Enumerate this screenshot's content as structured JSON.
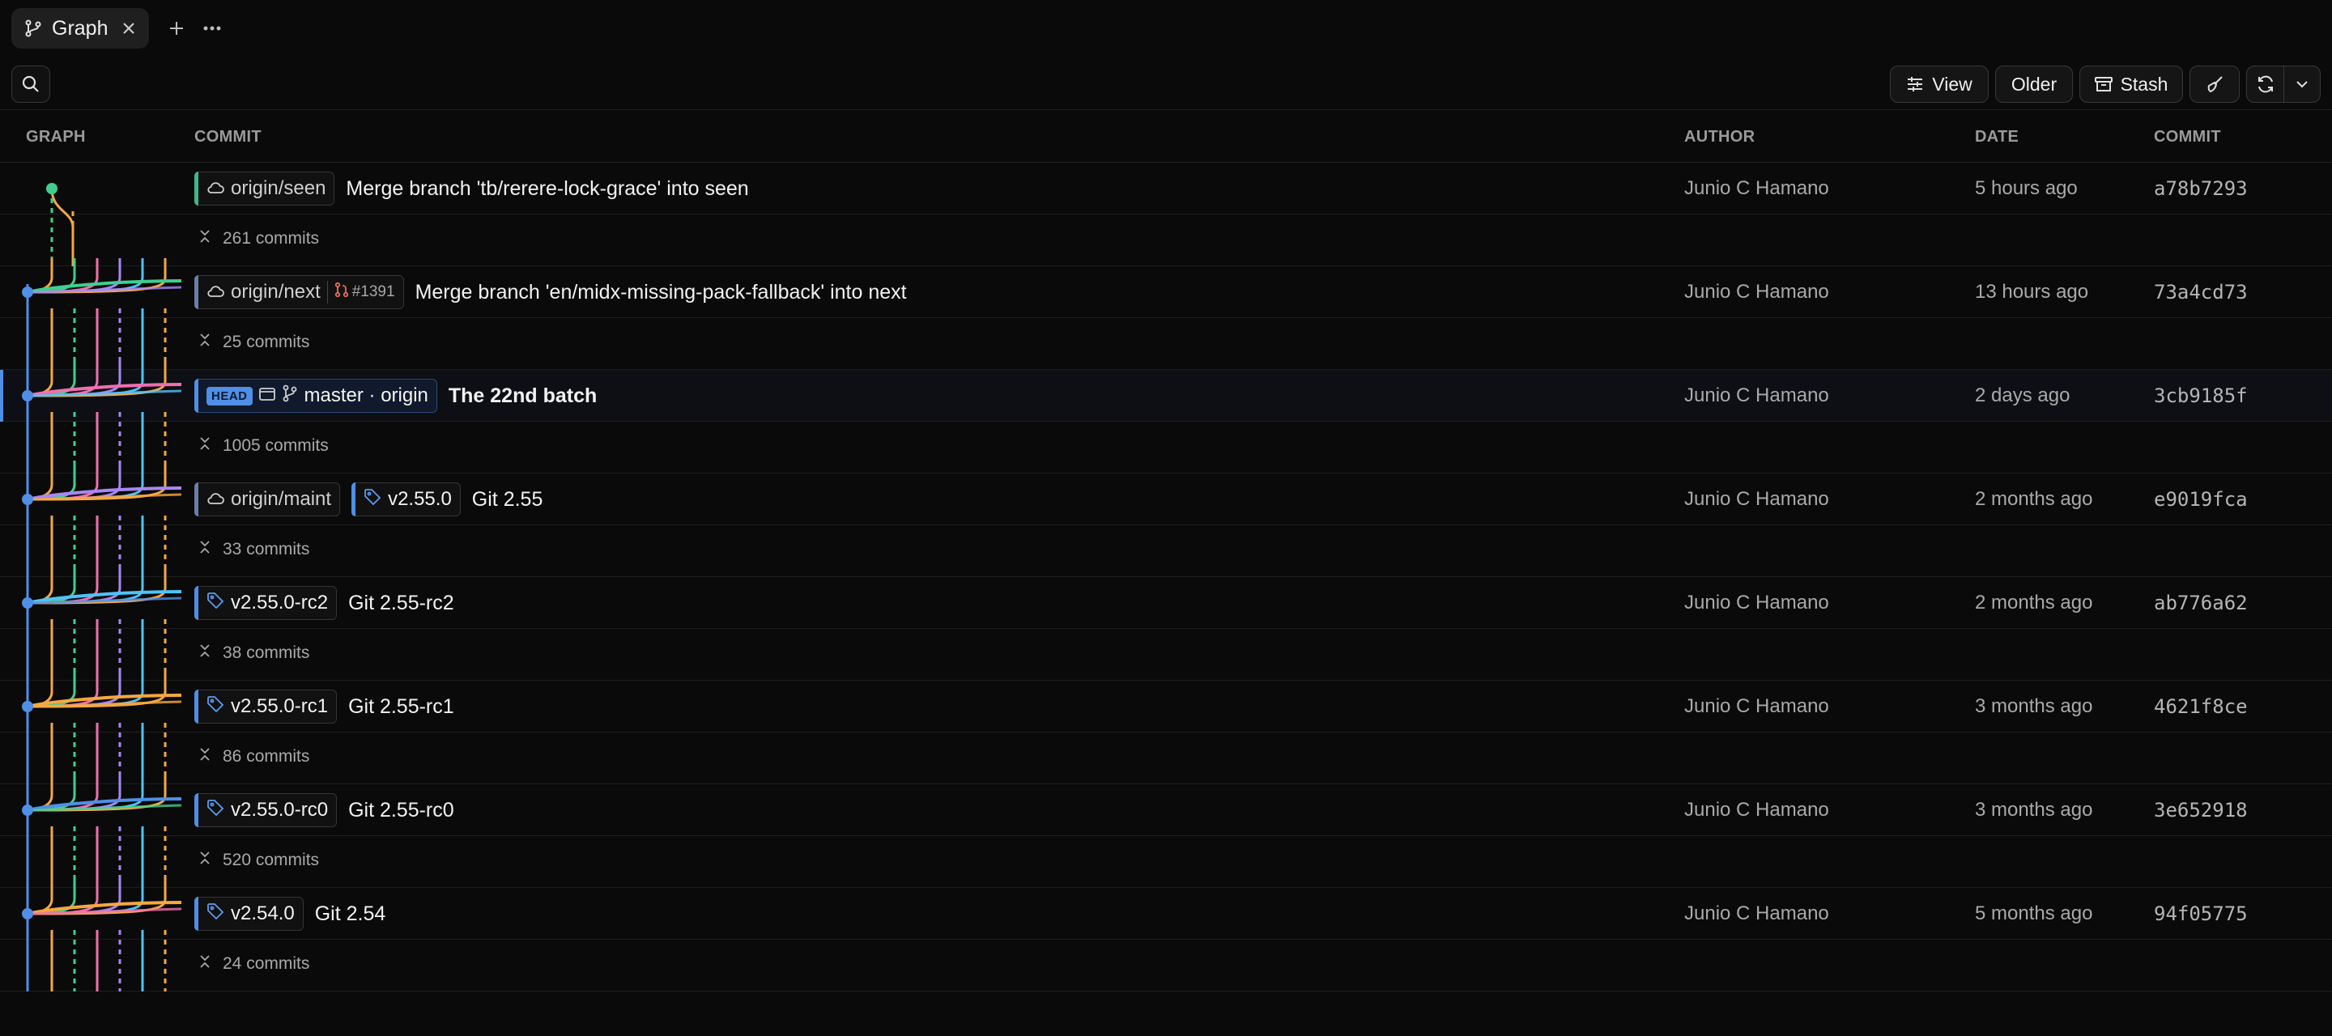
{
  "tab": {
    "label": "Graph",
    "icon": "git-graph-icon"
  },
  "toolbar": {
    "view_label": "View",
    "older_label": "Older",
    "stash_label": "Stash"
  },
  "columns": {
    "graph": "GRAPH",
    "commit": "COMMIT",
    "author": "AUTHOR",
    "date": "DATE",
    "sha": "COMMIT"
  },
  "rows": [
    {
      "refs": [
        {
          "type": "remote",
          "label": "origin/seen",
          "color": "#3fb58f"
        }
      ],
      "message": "Merge branch 'tb/rerere-lock-grace' into seen",
      "author": "Junio C Hamano",
      "date": "5 hours ago",
      "sha": "a78b7293",
      "collapsed": "261 commits"
    },
    {
      "refs": [
        {
          "type": "remote",
          "label": "origin/next",
          "pr": "#1391",
          "color": "#6a7fa8"
        }
      ],
      "message": "Merge branch 'en/midx-missing-pack-fallback' into next",
      "author": "Junio C Hamano",
      "date": "13 hours ago",
      "sha": "73a4cd73",
      "collapsed": "25 commits"
    },
    {
      "refs": [
        {
          "type": "head",
          "badge": "HEAD",
          "label": "master · origin",
          "color": "#4f8fe6"
        }
      ],
      "message": "The 22nd batch",
      "author": "Junio C Hamano",
      "date": "2 days ago",
      "sha": "3cb9185f",
      "collapsed": "1005 commits",
      "is_head": true
    },
    {
      "refs": [
        {
          "type": "remote",
          "label": "origin/maint",
          "color": "#6a7fa8"
        },
        {
          "type": "tag",
          "label": "v2.55.0",
          "color": "#4f8fe6"
        }
      ],
      "message": "Git 2.55",
      "author": "Junio C Hamano",
      "date": "2 months ago",
      "sha": "e9019fca",
      "collapsed": "33 commits"
    },
    {
      "refs": [
        {
          "type": "tag",
          "label": "v2.55.0-rc2",
          "color": "#4f8fe6"
        }
      ],
      "message": "Git 2.55-rc2",
      "author": "Junio C Hamano",
      "date": "2 months ago",
      "sha": "ab776a62",
      "collapsed": "38 commits"
    },
    {
      "refs": [
        {
          "type": "tag",
          "label": "v2.55.0-rc1",
          "color": "#4f8fe6"
        }
      ],
      "message": "Git 2.55-rc1",
      "author": "Junio C Hamano",
      "date": "3 months ago",
      "sha": "4621f8ce",
      "collapsed": "86 commits"
    },
    {
      "refs": [
        {
          "type": "tag",
          "label": "v2.55.0-rc0",
          "color": "#4f8fe6"
        }
      ],
      "message": "Git 2.55-rc0",
      "author": "Junio C Hamano",
      "date": "3 months ago",
      "sha": "3e652918",
      "collapsed": "520 commits"
    },
    {
      "refs": [
        {
          "type": "tag",
          "label": "v2.54.0",
          "color": "#4f8fe6"
        }
      ],
      "message": "Git 2.54",
      "author": "Junio C Hamano",
      "date": "5 months ago",
      "sha": "94f05775",
      "collapsed": "24 commits"
    }
  ],
  "graph_colors": [
    "#4f8fe6",
    "#f5a742",
    "#3ecf8e",
    "#f06fb0",
    "#a887f5",
    "#4fc3f7",
    "#f5a742"
  ]
}
